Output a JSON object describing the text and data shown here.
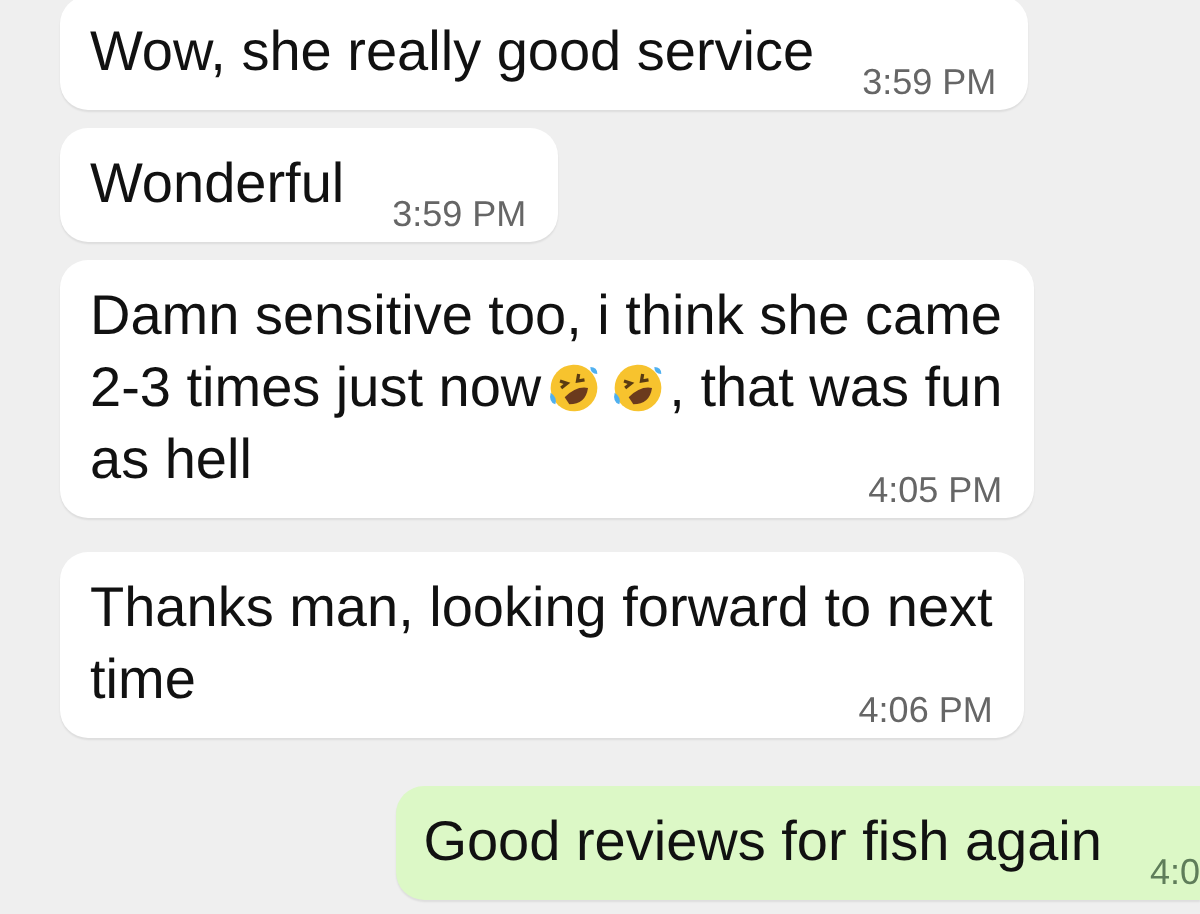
{
  "messages": [
    {
      "outgoing": false,
      "lines": [
        [
          {
            "kind": "text",
            "text": "Wow, she really good service"
          }
        ]
      ],
      "time": "3:59 PM"
    },
    {
      "outgoing": false,
      "lines": [
        [
          {
            "kind": "text",
            "text": "Wonderful"
          }
        ]
      ],
      "time": "3:59 PM"
    },
    {
      "outgoing": false,
      "lines": [
        [
          {
            "kind": "text",
            "text": "Damn sensitive too, i think she came"
          }
        ],
        [
          {
            "kind": "text",
            "text": "2-3 times just now"
          },
          {
            "kind": "emoji"
          },
          {
            "kind": "emoji"
          },
          {
            "kind": "text",
            "text": ", that was fun"
          }
        ],
        [
          {
            "kind": "text",
            "text": "as hell"
          }
        ]
      ],
      "time": "4:05 PM"
    },
    {
      "outgoing": false,
      "lines": [
        [
          {
            "kind": "text",
            "text": "Thanks man, looking forward to next"
          }
        ],
        [
          {
            "kind": "text",
            "text": "time"
          }
        ]
      ],
      "time": "4:06 PM"
    },
    {
      "outgoing": true,
      "lines": [
        [
          {
            "kind": "text",
            "text": "Good reviews for fish again"
          }
        ]
      ],
      "time": "4:0"
    }
  ]
}
